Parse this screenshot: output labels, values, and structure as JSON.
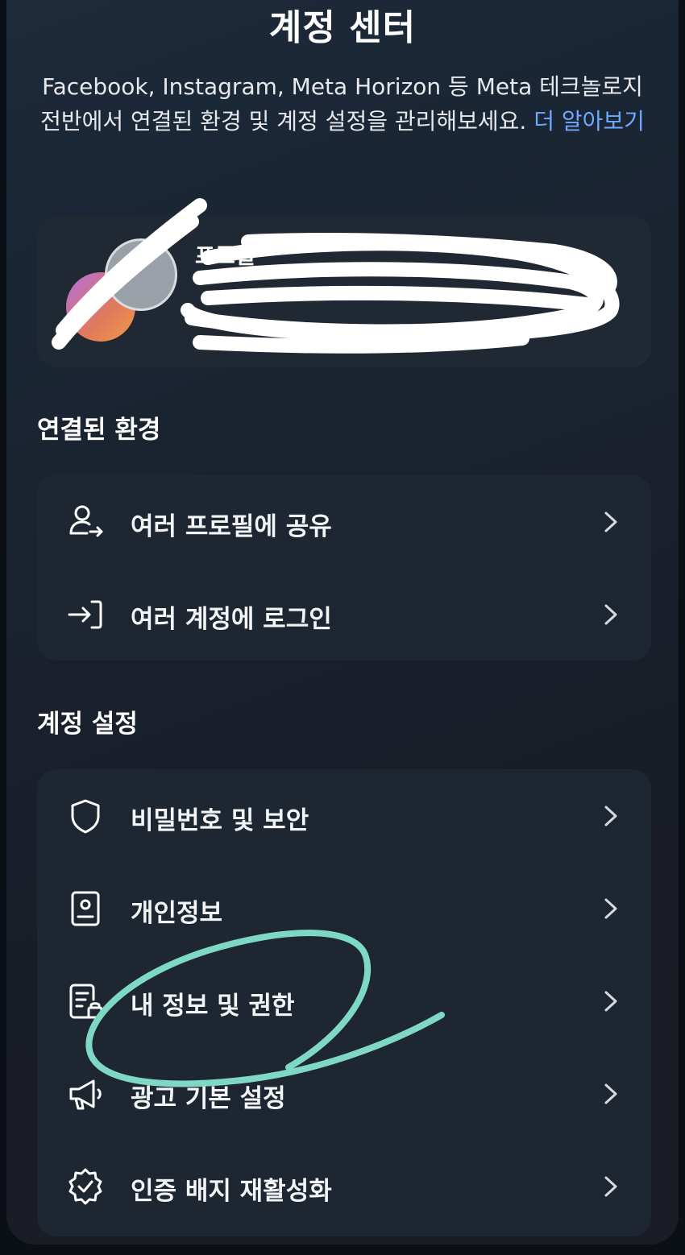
{
  "header": {
    "title": "계정 센터",
    "description": "Facebook, Instagram, Meta Horizon 등 Meta 테크놀로지 전반에서 연결된 환경 및 계정 설정을 관리해보세요.",
    "learn_more_link": "더 알아보기"
  },
  "profile_card": {
    "title": "프로필",
    "subtitle": "",
    "detail": "",
    "chevron_icon": "chevron-right-icon"
  },
  "connected": {
    "section_label": "연결된 환경",
    "items": [
      {
        "label": "여러 프로필에 공유",
        "icon": "share-profiles-icon"
      },
      {
        "label": "여러 계정에 로그인",
        "icon": "login-arrow-icon"
      }
    ]
  },
  "account_settings": {
    "section_label": "계정 설정",
    "items": [
      {
        "label": "비밀번호 및 보안",
        "icon": "shield-icon"
      },
      {
        "label": "개인정보",
        "icon": "id-card-icon"
      },
      {
        "label": "내 정보 및 권한",
        "icon": "document-lock-icon"
      },
      {
        "label": "광고 기본 설정",
        "icon": "megaphone-icon"
      },
      {
        "label": "인증 배지 재활성화",
        "icon": "verified-badge-icon"
      }
    ]
  },
  "colors": {
    "link": "#6ea8ff",
    "annotation": "#7ed8c4",
    "card_bg": "#1e2632"
  }
}
